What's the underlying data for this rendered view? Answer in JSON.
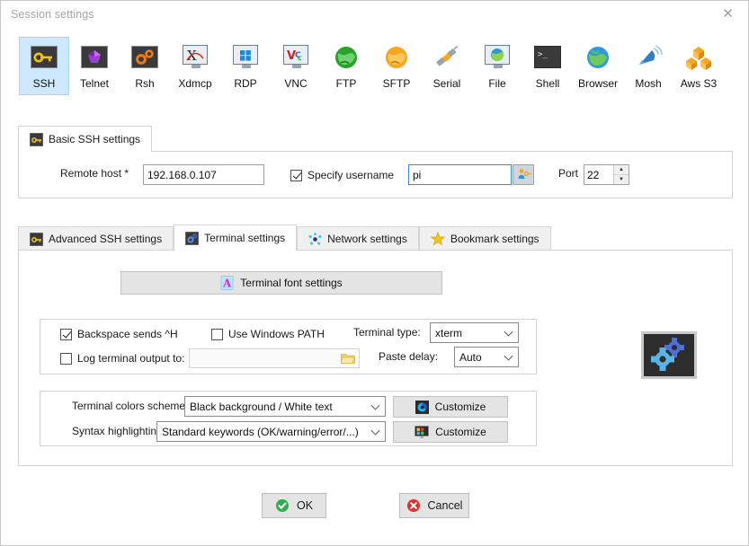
{
  "window": {
    "title": "Session settings",
    "close_icon": "close-icon"
  },
  "protocols": [
    {
      "id": "ssh",
      "label": "SSH",
      "icon": "ssh-key-icon",
      "selected": true
    },
    {
      "id": "telnet",
      "label": "Telnet",
      "icon": "telnet-gem-icon",
      "selected": false
    },
    {
      "id": "rsh",
      "label": "Rsh",
      "icon": "rsh-gears-icon",
      "selected": false
    },
    {
      "id": "xdmcp",
      "label": "Xdmcp",
      "icon": "xdmcp-monitor-icon",
      "selected": false
    },
    {
      "id": "rdp",
      "label": "RDP",
      "icon": "rdp-monitor-icon",
      "selected": false
    },
    {
      "id": "vnc",
      "label": "VNC",
      "icon": "vnc-monitor-icon",
      "selected": false
    },
    {
      "id": "ftp",
      "label": "FTP",
      "icon": "ftp-globe-icon",
      "selected": false
    },
    {
      "id": "sftp",
      "label": "SFTP",
      "icon": "sftp-globe-icon",
      "selected": false
    },
    {
      "id": "serial",
      "label": "Serial",
      "icon": "serial-plug-icon",
      "selected": false
    },
    {
      "id": "file",
      "label": "File",
      "icon": "file-monitor-icon",
      "selected": false
    },
    {
      "id": "shell",
      "label": "Shell",
      "icon": "shell-console-icon",
      "selected": false
    },
    {
      "id": "browser",
      "label": "Browser",
      "icon": "browser-globe-icon",
      "selected": false
    },
    {
      "id": "mosh",
      "label": "Mosh",
      "icon": "mosh-dish-icon",
      "selected": false
    },
    {
      "id": "awss3",
      "label": "Aws S3",
      "icon": "aws-s3-boxes-icon",
      "selected": false
    }
  ],
  "basic_panel": {
    "tab_label": "Basic SSH settings",
    "tab_icon": "ssh-key-icon",
    "remote_host_label": "Remote host *",
    "remote_host_value": "192.168.0.107",
    "specify_username_label": "Specify username",
    "specify_username_checked": true,
    "username_value": "pi",
    "username_key_icon": "user-key-icon",
    "port_label": "Port",
    "port_value": "22"
  },
  "settings_tabs": [
    {
      "id": "advanced",
      "label": "Advanced SSH settings",
      "icon": "ssh-key-icon",
      "active": false
    },
    {
      "id": "terminal",
      "label": "Terminal settings",
      "icon": "terminal-gear-icon",
      "active": true
    },
    {
      "id": "network",
      "label": "Network settings",
      "icon": "network-node-icon",
      "active": false
    },
    {
      "id": "bookmark",
      "label": "Bookmark settings",
      "icon": "star-icon",
      "active": false
    }
  ],
  "terminal_panel": {
    "font_button_label": "Terminal font settings",
    "font_button_icon": "font-a-icon",
    "backspace_label": "Backspace sends ^H",
    "backspace_checked": true,
    "windows_path_label": "Use Windows PATH",
    "windows_path_checked": false,
    "log_output_label": "Log terminal output to:",
    "log_output_checked": false,
    "log_output_value": "",
    "log_output_browse_icon": "folder-icon",
    "terminal_type_label": "Terminal type:",
    "terminal_type_value": "xterm",
    "paste_delay_label": "Paste delay:",
    "paste_delay_value": "Auto",
    "preview_icon": "terminal-gears-preview-icon",
    "colors_scheme_label": "Terminal colors scheme:",
    "colors_scheme_value": "Black background / White text",
    "colors_customize_label": "Customize",
    "colors_customize_icon": "color-wheel-icon",
    "syntax_label": "Syntax highlighting:",
    "syntax_value": "Standard keywords (OK/warning/error/...)",
    "syntax_customize_label": "Customize",
    "syntax_customize_icon": "syntax-monitor-icon"
  },
  "footer": {
    "ok_label": "OK",
    "ok_icon": "check-circle-icon",
    "cancel_label": "Cancel",
    "cancel_icon": "x-circle-icon"
  },
  "colors": {
    "selection_bg": "#cde8ff",
    "focus_border": "#2a8fd8",
    "ok_green": "#2faf4c",
    "cancel_red": "#e02e2e",
    "accent_orange": "#f5a623"
  }
}
